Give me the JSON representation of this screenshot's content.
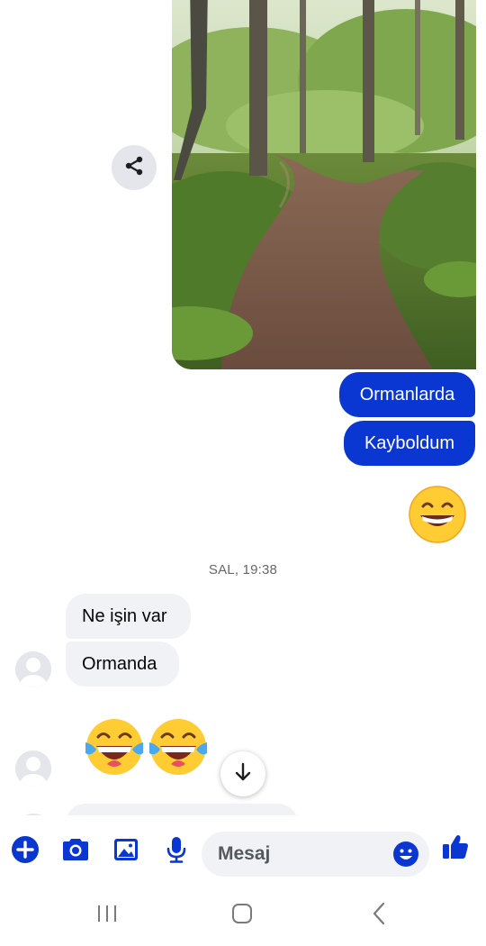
{
  "conversation": {
    "outgoing": [
      {
        "text": "Ormanlarda"
      },
      {
        "text": "Kayboldum"
      }
    ],
    "timestamp": "SAL, 19:38",
    "incoming": [
      {
        "text": "Ne işin var"
      },
      {
        "text": "Ormanda"
      }
    ],
    "emoji_sent": "grinning-face-with-smiling-eyes",
    "emoji_received": [
      "face-with-tears-of-joy",
      "face-with-tears-of-joy"
    ]
  },
  "composer": {
    "placeholder": "Mesaj",
    "tools": [
      "plus-icon",
      "camera-icon",
      "gallery-icon",
      "microphone-icon"
    ],
    "emoji_icon": "smiley-icon",
    "send_icon": "thumbs-up-icon"
  },
  "navbar": {
    "buttons": [
      "recents-icon",
      "home-icon",
      "back-icon"
    ]
  },
  "colors": {
    "accent": "#0a37d1",
    "incoming_bubble": "#f0f2f5",
    "share_button": "#e4e6eb",
    "timestamp_text": "#65676b"
  }
}
